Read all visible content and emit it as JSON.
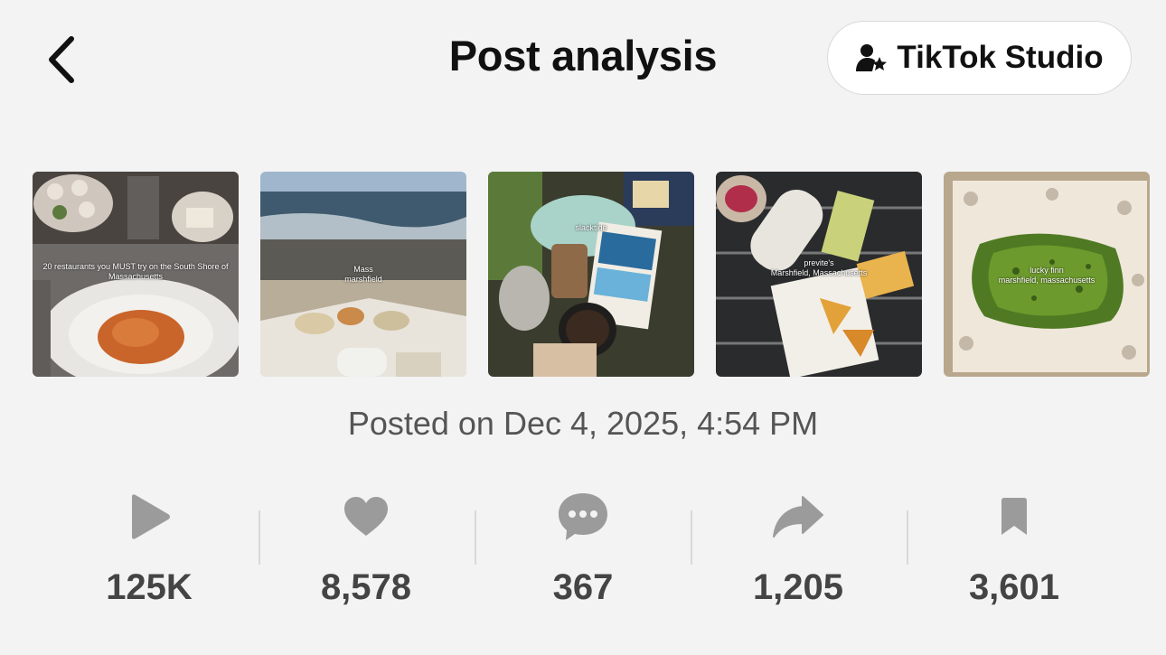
{
  "header": {
    "title": "Post analysis",
    "studio_button": "TikTok Studio"
  },
  "thumbnails": [
    {
      "caption": "20 restaurants you MUST try on the South Shore of Massachusetts"
    },
    {
      "caption": "Mass",
      "caption2": "marshfield"
    },
    {
      "caption": "slacktide"
    },
    {
      "caption": "previte's",
      "caption2": "Marshfield, Massachusetts"
    },
    {
      "caption": "lucky finn",
      "caption2": "marshfield, massachusetts"
    }
  ],
  "posted": "Posted on Dec 4, 2025, 4:54 PM",
  "stats": [
    {
      "icon": "play-icon",
      "value": "125K"
    },
    {
      "icon": "heart-icon",
      "value": "8,578"
    },
    {
      "icon": "comment-icon",
      "value": "367"
    },
    {
      "icon": "share-icon",
      "value": "1,205"
    },
    {
      "icon": "bookmark-icon",
      "value": "3,601"
    }
  ],
  "colors": {
    "icon_gray": "#9b9b9b",
    "text": "#111111"
  }
}
